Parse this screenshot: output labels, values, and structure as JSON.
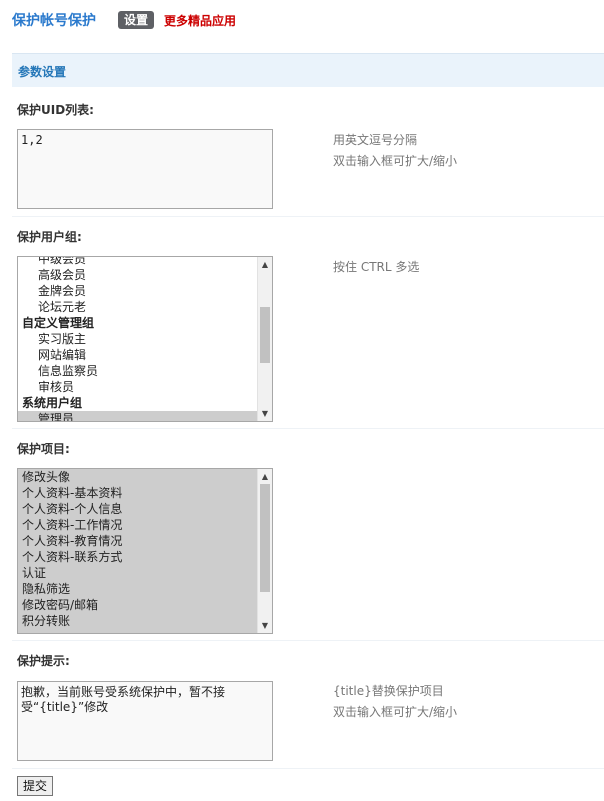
{
  "header": {
    "plugin_title": "保护帐号保护",
    "tab_settings": "设置",
    "more_apps": "更多精品应用"
  },
  "section": {
    "title": "参数设置"
  },
  "uid_list": {
    "label": "保护UID列表:",
    "value": "1,2",
    "hint_1": "用英文逗号分隔",
    "hint_2": "双击输入框可扩大/缩小"
  },
  "user_groups": {
    "label": "保护用户组:",
    "hint": "按住 CTRL 多选",
    "scroll_fraction": 0.45,
    "options": [
      {
        "text": "中级会员",
        "type": "member",
        "selected": false
      },
      {
        "text": "高级会员",
        "type": "member",
        "selected": false
      },
      {
        "text": "金牌会员",
        "type": "member",
        "selected": false
      },
      {
        "text": "论坛元老",
        "type": "member",
        "selected": false
      },
      {
        "text": "自定义管理组",
        "type": "group",
        "selected": false
      },
      {
        "text": "实习版主",
        "type": "member",
        "selected": false
      },
      {
        "text": "网站编辑",
        "type": "member",
        "selected": false
      },
      {
        "text": "信息监察员",
        "type": "member",
        "selected": false
      },
      {
        "text": "审核员",
        "type": "member",
        "selected": false
      },
      {
        "text": "系统用户组",
        "type": "group",
        "selected": false
      },
      {
        "text": "管理员",
        "type": "member",
        "selected": true
      }
    ]
  },
  "protect_items": {
    "label": "保护项目:",
    "scroll_fraction": 0.0,
    "options": [
      "修改头像",
      "个人资料-基本资料",
      "个人资料-个人信息",
      "个人资料-工作情况",
      "个人资料-教育情况",
      "个人资料-联系方式",
      "认证",
      "隐私筛选",
      "修改密码/邮箱",
      "积分转账"
    ]
  },
  "protect_tip": {
    "label": "保护提示:",
    "value": "抱歉，当前账号受系统保护中，暂不接受“{title}”修改",
    "hint_1": "{title}替换保护项目",
    "hint_2": "双击输入框可扩大/缩小"
  },
  "submit_label": "提交"
}
